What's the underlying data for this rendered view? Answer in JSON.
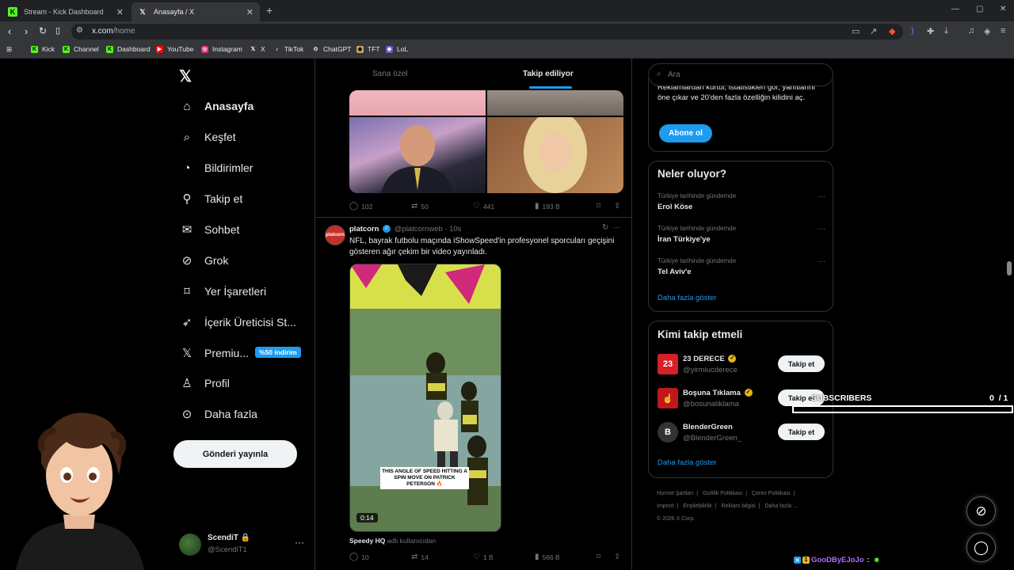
{
  "browser": {
    "tabs": [
      {
        "title": "Stream - Kick Dashboard",
        "active": false
      },
      {
        "title": "Anasayfa / X",
        "active": true
      }
    ],
    "url_host": "x.com",
    "url_path": "/home",
    "bookmarks": [
      "Kick",
      "Channel",
      "Dashboard",
      "YouTube",
      "Instagram",
      "X",
      "TikTok",
      "ChatGPT",
      "TFT",
      "LoL"
    ]
  },
  "nav": {
    "items": [
      {
        "label": "Anasayfa",
        "icon": "home-icon"
      },
      {
        "label": "Keşfet",
        "icon": "search-icon"
      },
      {
        "label": "Bildirimler",
        "icon": "bell-icon"
      },
      {
        "label": "Takip et",
        "icon": "person-add-icon"
      },
      {
        "label": "Sohbet",
        "icon": "mail-icon"
      },
      {
        "label": "Grok",
        "icon": "grok-icon"
      },
      {
        "label": "Yer İşaretleri",
        "icon": "bookmark-icon"
      },
      {
        "label": "İçerik Üreticisi St...",
        "icon": "rocket-icon"
      },
      {
        "label": "Premiu...",
        "icon": "x-premium-icon"
      },
      {
        "label": "Profil",
        "icon": "user-icon"
      },
      {
        "label": "Daha fazla",
        "icon": "more-circle-icon"
      }
    ],
    "premium_badge": "%50 indirim",
    "post_button": "Gönderi yayınla",
    "profile": {
      "name": "ScendiT",
      "handle": "@ScendiT1"
    }
  },
  "timeline": {
    "tabs": [
      "Sana özel",
      "Takip ediliyor"
    ],
    "post1_stats": {
      "replies": "102",
      "reposts": "50",
      "likes": "441",
      "views": "193 B"
    },
    "post2": {
      "avatar_text": "platcorn",
      "author": "platcorn",
      "handle": "@platcornweb",
      "time": "· 10s",
      "text": "NFL, bayrak futbolu maçında iShowSpeed'in profesyonel sporcuları geçişini gösteren ağır çekim bir video yayınladı.",
      "video_caption": "THIS ANGLE OF SPEED HITTING A SPIN MOVE ON PATRICK PETERSON 🔥",
      "video_time": "0:14",
      "via_user": "Speedy HQ",
      "via_text": "adlı kullanıcıdan",
      "stats": {
        "replies": "10",
        "reposts": "14",
        "likes": "1 B",
        "views": "566 B"
      }
    }
  },
  "sidebar": {
    "search_placeholder": "Ara",
    "premium_text": "Reklamlardan kurtul, istatistikleri gör, yanıtlarını öne çıkar ve 20'den fazla özelliğin kilidini aç.",
    "subscribe_button": "Abone ol",
    "trends_title": "Neler oluyor?",
    "trends": [
      {
        "context": "Türkiye tarihinde gündemde",
        "name": "Erol Köse"
      },
      {
        "context": "Türkiye tarihinde gündemde",
        "name": "İran Türkiye'ye"
      },
      {
        "context": "Türkiye tarihinde gündemde",
        "name": "Tel Aviv'e"
      }
    ],
    "show_more": "Daha fazla göster",
    "who_title": "Kimi takip etmeli",
    "who": [
      {
        "name": "23 DERECE",
        "handle": "@yirmiucderece",
        "avatar_text": "23",
        "color": "#d62027"
      },
      {
        "name": "Boşuna Tıklama",
        "handle": "@bosunatiklama",
        "avatar_text": "☝",
        "color": "#c0171d"
      },
      {
        "name": "BlenderGreen",
        "handle": "@BlenderGreen_",
        "avatar_text": "B",
        "color": "#333333"
      }
    ],
    "follow_button": "Takip et",
    "footer_row1": [
      "Hizmet Şartları",
      "|",
      "Gizlilik Politikası",
      "|",
      "Çerez Politikası",
      "|"
    ],
    "footer_row2": [
      "Imprint",
      "|",
      "Erişilebilirlik",
      "|",
      "Reklam bilgisi",
      "|",
      "Daha fazla ..."
    ],
    "footer_row3": "© 2026 X Corp."
  },
  "overlay": {
    "subscribers_label": "SUBSCRIBERS",
    "subscribers_count": "0",
    "subscribers_goal": "/ 1",
    "subscribers_progress": 0,
    "chat_user": "GooDByEJoJo",
    "chat_sep": ":"
  },
  "colors": {
    "accent": "#1d9bf0",
    "background": "#000000",
    "border": "#2f3336",
    "muted": "#71767b"
  }
}
